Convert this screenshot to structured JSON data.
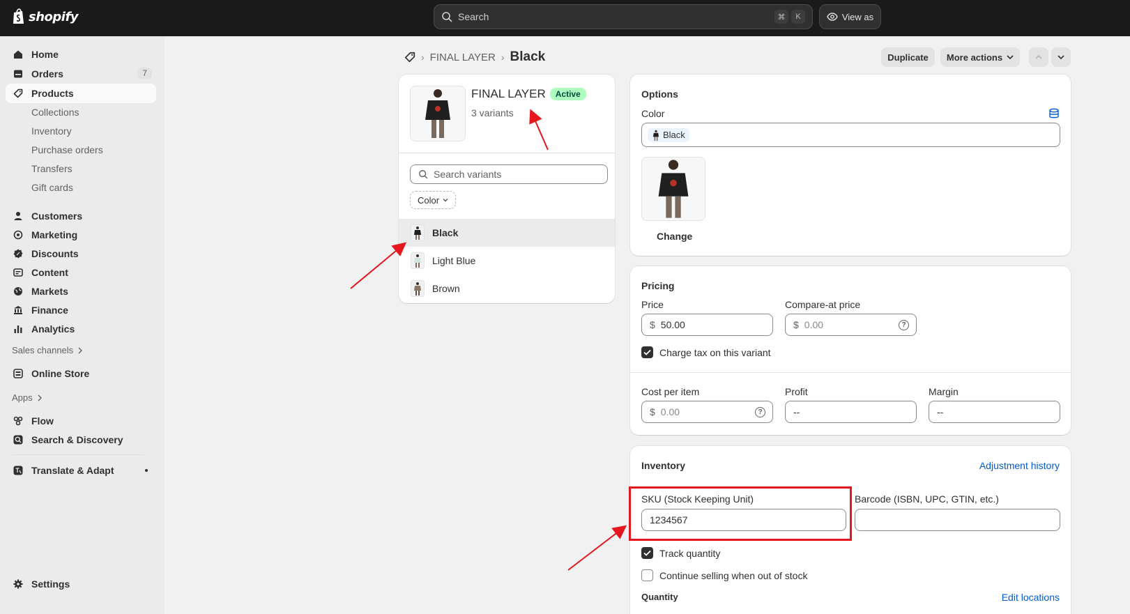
{
  "topbar": {
    "brand": "shopify",
    "search_placeholder": "Search",
    "shortcut_keys": [
      "⌘",
      "K"
    ],
    "view_as_label": "View as"
  },
  "sidebar": {
    "primary": [
      {
        "label": "Home",
        "icon": "home-icon"
      },
      {
        "label": "Orders",
        "icon": "orders-icon",
        "badge": "7"
      },
      {
        "label": "Products",
        "icon": "tag-icon",
        "active": true
      }
    ],
    "products_sub": [
      "Collections",
      "Inventory",
      "Purchase orders",
      "Transfers",
      "Gift cards"
    ],
    "secondary": [
      {
        "label": "Customers",
        "icon": "person-icon"
      },
      {
        "label": "Marketing",
        "icon": "target-icon"
      },
      {
        "label": "Discounts",
        "icon": "discount-icon"
      },
      {
        "label": "Content",
        "icon": "content-icon"
      },
      {
        "label": "Markets",
        "icon": "globe-icon"
      },
      {
        "label": "Finance",
        "icon": "bank-icon"
      },
      {
        "label": "Analytics",
        "icon": "chart-icon"
      }
    ],
    "sales_channels_label": "Sales channels",
    "online_store": "Online Store",
    "apps_label": "Apps",
    "apps": [
      {
        "label": "Flow",
        "icon": "flow-icon"
      },
      {
        "label": "Search & Discovery",
        "icon": "search-discovery-icon"
      }
    ],
    "translate": "Translate & Adapt",
    "settings": "Settings"
  },
  "header": {
    "breadcrumb_parent": "FINAL LAYER",
    "breadcrumb_current": "Black",
    "duplicate_label": "Duplicate",
    "more_actions_label": "More actions"
  },
  "product_card": {
    "title": "FINAL LAYER",
    "status": "Active",
    "variant_count": "3 variants",
    "search_placeholder": "Search variants",
    "filter_label": "Color",
    "variants": [
      "Black",
      "Light Blue",
      "Brown"
    ],
    "selected_variant": "Black"
  },
  "options_card": {
    "title": "Options",
    "color_label": "Color",
    "color_value": "Black",
    "change_label": "Change"
  },
  "pricing_card": {
    "title": "Pricing",
    "price_label": "Price",
    "currency": "$",
    "price_value": "50.00",
    "compare_label": "Compare-at price",
    "compare_placeholder": "0.00",
    "charge_tax_label": "Charge tax on this variant",
    "cost_label": "Cost per item",
    "cost_placeholder": "0.00",
    "profit_label": "Profit",
    "profit_value": "--",
    "margin_label": "Margin",
    "margin_value": "--"
  },
  "inventory_card": {
    "title": "Inventory",
    "adjustment_link": "Adjustment history",
    "sku_label": "SKU (Stock Keeping Unit)",
    "sku_value": "1234567",
    "barcode_label": "Barcode (ISBN, UPC, GTIN, etc.)",
    "barcode_value": "",
    "track_quantity_label": "Track quantity",
    "continue_selling_label": "Continue selling when out of stock",
    "quantity_label": "Quantity",
    "edit_locations_link": "Edit locations"
  },
  "colors": {
    "topbar": "#1a1a1a",
    "sidebar": "#ebebeb",
    "accent_link": "#005bd3",
    "active_badge": "#affebf",
    "annotation": "#e4161e"
  }
}
